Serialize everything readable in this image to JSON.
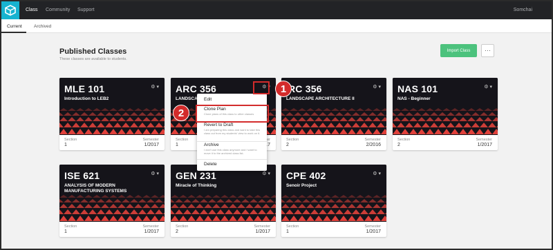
{
  "nav": {
    "tabs": [
      {
        "label": "Class"
      },
      {
        "label": "Community"
      },
      {
        "label": "Support"
      }
    ],
    "user": "Somchai"
  },
  "subnav": {
    "tabs": [
      {
        "label": "Current"
      },
      {
        "label": "Archived"
      }
    ]
  },
  "page": {
    "title": "Published Classes",
    "subtitle": "These classes are available to students.",
    "import_label": "Import Class",
    "more_label": "···"
  },
  "cards": [
    {
      "code": "MLE 101",
      "name": "Introduction to LEB2",
      "section_label": "Section",
      "section": "1",
      "semester_label": "Semester",
      "semester": "1/2017"
    },
    {
      "code": "ARC 356",
      "name": "LANDSCA",
      "section_label": "Section",
      "section": "1",
      "semester_label": "Semester",
      "semester": "1/2017"
    },
    {
      "code": "RC 356",
      "name": "LANDSCAPE ARCHITECTURE II",
      "section_label": "Section",
      "section": "2",
      "semester_label": "Semester",
      "semester": "2/2016"
    },
    {
      "code": "NAS 101",
      "name": "NAS - Beginner",
      "section_label": "Section",
      "section": "2",
      "semester_label": "Semester",
      "semester": "1/2017"
    },
    {
      "code": "ISE 621",
      "name": "ANALYSIS OF MODERN MANUFACTURING SYSTEMS",
      "section_label": "Section",
      "section": "1",
      "semester_label": "Semester",
      "semester": "1/2017"
    },
    {
      "code": "GEN 231",
      "name": "Miracle of Thinking",
      "section_label": "Section",
      "section": "2",
      "semester_label": "Semester",
      "semester": "1/2017"
    },
    {
      "code": "CPE 402",
      "name": "Senoir Project",
      "section_label": "Section",
      "section": "1",
      "semester_label": "Semester",
      "semester": "1/2017"
    }
  ],
  "dropdown": {
    "edit": "Edit",
    "clone": {
      "title": "Clone Plan",
      "desc": "Clone plans of this class to other classes"
    },
    "revert": {
      "title": "Revert to Draft",
      "desc": "I am preparing this class and want to take this class out from my students' view to work on it."
    },
    "archive": {
      "title": "Archive",
      "desc": "I don't use this class anymore and I want to move it to the archived class list."
    },
    "delete": "Delete"
  },
  "annotations": {
    "step1": "1",
    "step2": "2",
    "color": "#d32b2b"
  },
  "icons": {
    "logo": "cube-logo-icon",
    "gear": "gear-icon",
    "caret": "caret-down-icon"
  },
  "colors": {
    "topbar": "#222326",
    "logo": "#17b3d0",
    "import": "#4cc27d",
    "pattern": "#e0413b",
    "card_header": "#15141a"
  }
}
